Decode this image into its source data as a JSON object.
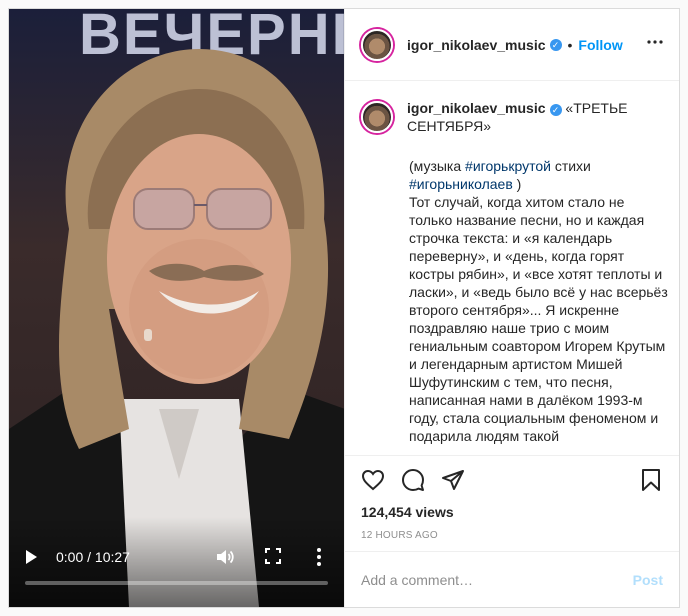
{
  "video": {
    "background_lettering": "ВЕЧЕРНІ",
    "time_display": "0:00 / 10:27",
    "progress": 0
  },
  "header": {
    "username": "igor_nikolaev_music",
    "separator": "•",
    "follow_label": "Follow"
  },
  "caption": {
    "username": "igor_nikolaev_music",
    "title": "«ТРЕТЬЕ СЕНТЯБРЯ»",
    "line1_prefix": "(музыка ",
    "hashtag1": "#игорькрутой",
    "line1_mid": " стихи ",
    "hashtag2": "#игорьниколаев",
    "line1_suffix": " )",
    "body": "Тот случай, когда хитом стало не только название песни, но и каждая строчка текста: и «я календарь переверну», и «день, когда горят костры рябин», и «все хотят теплоты и ласки», и «ведь было всё у нас всерьёз второго сентября»... Я искренне поздравляю наше трио с моим гениальным соавтором Игорем Крутым и легендарным артистом Мишей Шуфутинским с тем, что песня, написанная нами в далёком 1993-м году, стала социальным феноменом и подарила людям такой"
  },
  "stats": {
    "views": "124,454 views",
    "time_ago": "12 HOURS AGO"
  },
  "comment": {
    "placeholder": "Add a comment…",
    "post_label": "Post"
  },
  "icons": [
    "play-icon",
    "volume-icon",
    "fullscreen-icon",
    "more-vertical-icon",
    "more-horizontal-icon",
    "heart-icon",
    "comment-icon",
    "share-icon",
    "bookmark-icon",
    "verified-icon"
  ],
  "colors": {
    "link_blue": "#0095f6",
    "hashtag": "#00376b",
    "verified": "#3897f0",
    "post_disabled": "#b2dffc"
  }
}
